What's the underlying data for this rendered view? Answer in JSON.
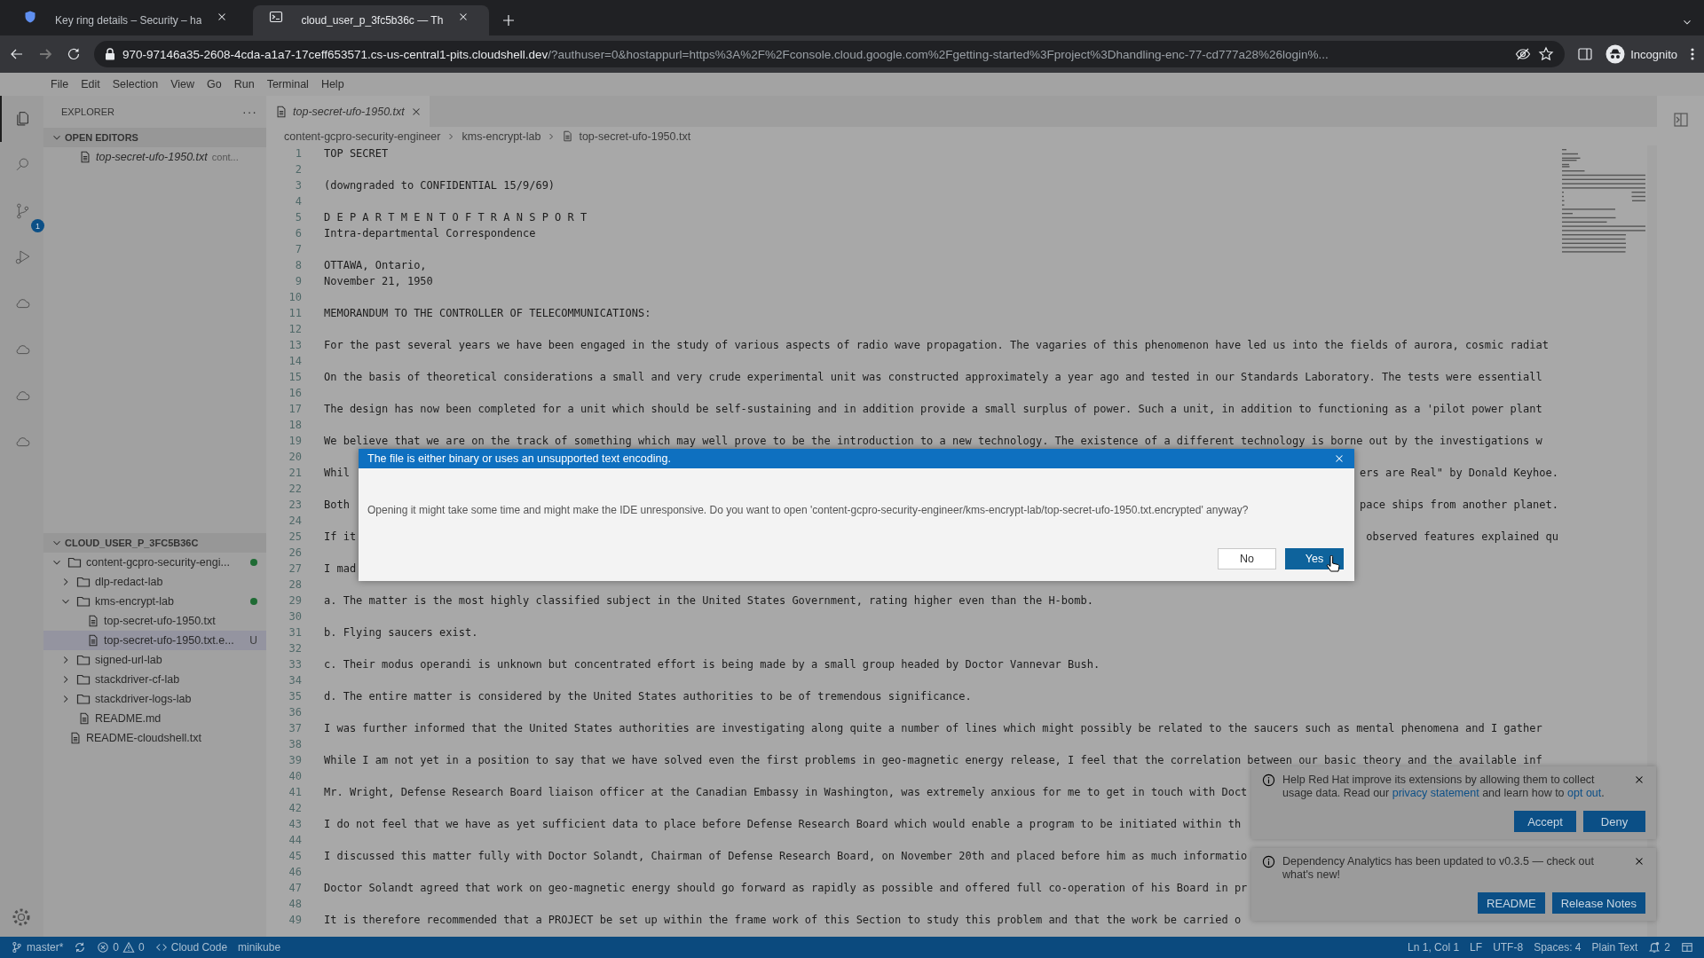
{
  "browser": {
    "tabs": [
      {
        "title": "Key ring details – Security – ha",
        "selected": false
      },
      {
        "title": "cloud_user_p_3fc5b36c — Th",
        "selected": true
      }
    ],
    "url_host": "970-97146a35-2608-4cda-a1a7-17ceff653571.cs-us-central1-pits.cloudshell.dev",
    "url_rest": "/?authuser=0&hostappurl=https%3A%2F%2Fconsole.cloud.google.com%2Fgetting-started%3Fproject%3Dhandling-enc-77-cd777a28%26login%...",
    "profile": "Incognito"
  },
  "menu": [
    "File",
    "Edit",
    "Selection",
    "View",
    "Go",
    "Run",
    "Terminal",
    "Help"
  ],
  "activity_bar": [
    {
      "kind": "explorer",
      "selected": true
    },
    {
      "kind": "search",
      "selected": false
    },
    {
      "kind": "source-control",
      "selected": false,
      "badge": "1"
    },
    {
      "kind": "run-debug",
      "selected": false
    },
    {
      "kind": "cloud",
      "selected": false
    },
    {
      "kind": "cloud",
      "selected": false
    },
    {
      "kind": "cloud",
      "selected": false
    },
    {
      "kind": "cloud",
      "selected": false
    }
  ],
  "sidebar": {
    "title": "EXPLORER",
    "more": "···",
    "open_editors": {
      "title": "OPEN EDITORS",
      "expanded": true,
      "items": [
        {
          "name": "top-secret-ufo-1950.txt",
          "folder": "cont..."
        }
      ]
    },
    "workspace": {
      "title": "CLOUD_USER_P_3FC5B36C",
      "expanded": true,
      "tree": [
        {
          "name": "content-gcpro-security-engi...",
          "kind": "folder",
          "expanded": true,
          "modified": true,
          "selected": false,
          "children": [
            {
              "name": "dlp-redact-lab",
              "kind": "folder",
              "expanded": false,
              "modified": false,
              "selected": false
            },
            {
              "name": "kms-encrypt-lab",
              "kind": "folder",
              "expanded": true,
              "modified": true,
              "selected": false,
              "children": [
                {
                  "name": "top-secret-ufo-1950.txt",
                  "kind": "file",
                  "selected": false
                },
                {
                  "name": "top-secret-ufo-1950.txt.e...",
                  "kind": "file",
                  "selected": true,
                  "status": "U"
                }
              ]
            },
            {
              "name": "signed-url-lab",
              "kind": "folder",
              "expanded": false,
              "modified": false,
              "selected": false
            },
            {
              "name": "stackdriver-cf-lab",
              "kind": "folder",
              "expanded": false,
              "modified": false,
              "selected": false
            },
            {
              "name": "stackdriver-logs-lab",
              "kind": "folder",
              "expanded": false,
              "modified": false,
              "selected": false
            },
            {
              "name": "README.md",
              "kind": "file",
              "selected": false
            }
          ]
        },
        {
          "name": "README-cloudshell.txt",
          "kind": "file",
          "selected": false
        }
      ]
    }
  },
  "editor": {
    "tabs": [
      {
        "title": "top-secret-ufo-1950.txt",
        "selected": true,
        "preview": true
      }
    ],
    "breadcrumb": [
      "content-gcpro-security-engineer",
      "kms-encrypt-lab",
      "top-secret-ufo-1950.txt"
    ],
    "lines": [
      {
        "number": "1",
        "text": "TOP SECRET"
      },
      {
        "number": "2"
      },
      {
        "number": "3",
        "text": "(downgraded to CONFIDENTIAL 15/9/69)"
      },
      {
        "number": "4"
      },
      {
        "number": "5",
        "text": "D E P A R T M E N T O F T R A N S P O R T"
      },
      {
        "number": "6",
        "text": "Intra-departmental Correspondence"
      },
      {
        "number": "7"
      },
      {
        "number": "8",
        "text": "OTTAWA, Ontario,"
      },
      {
        "number": "9",
        "text": "November 21, 1950"
      },
      {
        "number": "10"
      },
      {
        "number": "11",
        "text": "MEMORANDUM TO THE CONTROLLER OF TELECOMMUNICATIONS:"
      },
      {
        "number": "12"
      },
      {
        "number": "13",
        "text": "For the past several years we have been engaged in the study of various aspects of radio wave propagation. The vagaries of this phenomenon have led us into the fields of aurora, cosmic radiat"
      },
      {
        "number": "14"
      },
      {
        "number": "15",
        "text": "On the basis of theoretical considerations a small and very crude experimental unit was constructed approximately a year ago and tested in our Standards Laboratory. The tests were essentiall"
      },
      {
        "number": "16"
      },
      {
        "number": "17",
        "text": "The design has now been completed for a unit which should be self-sustaining and in addition provide a small surplus of power. Such a unit, in addition to functioning as a 'pilot power plant"
      },
      {
        "number": "18"
      },
      {
        "number": "19",
        "text": "We believe that we are on the track of something which may well prove to be the introduction to a new technology. The existence of a different technology is borne out by the investigations w"
      },
      {
        "number": "20"
      },
      {
        "number": "21",
        "text": "Whil",
        "text_right": "ers are Real\" by Donald Keyhoe."
      },
      {
        "number": "22"
      },
      {
        "number": "23",
        "text": "Both",
        "text_right": "pace ships from another planet."
      },
      {
        "number": "24"
      },
      {
        "number": "25",
        "text": "If it",
        "text_right": "observed features explained qu"
      },
      {
        "number": "26"
      },
      {
        "number": "27",
        "text": "I mad"
      },
      {
        "number": "28"
      },
      {
        "number": "29",
        "text": "a. The matter is the most highly classified subject in the United States Government, rating higher even than the H-bomb."
      },
      {
        "number": "30"
      },
      {
        "number": "31",
        "text": "b. Flying saucers exist."
      },
      {
        "number": "32"
      },
      {
        "number": "33",
        "text": "c. Their modus operandi is unknown but concentrated effort is being made by a small group headed by Doctor Vannevar Bush."
      },
      {
        "number": "34"
      },
      {
        "number": "35",
        "text": "d. The entire matter is considered by the United States authorities to be of tremendous significance."
      },
      {
        "number": "36"
      },
      {
        "number": "37",
        "text": "I was further informed that the United States authorities are investigating along quite a number of lines which might possibly be related to the saucers such as mental phenomena and I gather"
      },
      {
        "number": "38"
      },
      {
        "number": "39",
        "text": "While I am not yet in a position to say that we have solved even the first problems in geo-magnetic energy release, I feel that the correlation between our basic theory and the available inf"
      },
      {
        "number": "40"
      },
      {
        "number": "41",
        "text": "Mr. Wright, Defense Research Board liaison officer at the Canadian Embassy in Washington, was extremely anxious for me to get in touch with Doct"
      },
      {
        "number": "42"
      },
      {
        "number": "43",
        "text": "I do not feel that we have as yet sufficient data to place before Defense Research Board which would enable a program to be initiated within th"
      },
      {
        "number": "44"
      },
      {
        "number": "45",
        "text": "I discussed this matter fully with Doctor Solandt, Chairman of Defense Research Board, on November 20th and placed before him as much informatio"
      },
      {
        "number": "46"
      },
      {
        "number": "47",
        "text": "Doctor Solandt agreed that work on geo-magnetic energy should go forward as rapidly as possible and offered full co-operation of his Board in pr"
      },
      {
        "number": "48"
      },
      {
        "number": "49",
        "text": "It is therefore recommended that a PROJECT be set up within the frame work of this Section to study this problem and that the work be carried o"
      }
    ]
  },
  "dialog": {
    "title": "The file is either binary or uses an unsupported text encoding.",
    "message": "Opening it might take some time and might make the IDE unresponsive. Do you want to open 'content-gcpro-security-engineer/kms-encrypt-lab/top-secret-ufo-1950.txt.encrypted' anyway?",
    "buttons": [
      {
        "label": "No",
        "primary": false
      },
      {
        "label": "Yes",
        "primary": true
      }
    ]
  },
  "notifications": [
    {
      "message": [
        {
          "text": "Help Red Hat improve its extensions by allowing them to collect usage data. Read our ",
          "link": false
        },
        {
          "text": "privacy statement",
          "link": true
        },
        {
          "text": " and learn how to ",
          "link": false
        },
        {
          "text": "opt out",
          "link": true
        },
        {
          "text": ".",
          "link": false
        }
      ],
      "buttons": [
        "Accept",
        "Deny"
      ]
    },
    {
      "message": [
        {
          "text": "Dependency Analytics has been updated to v0.3.5 — check out what's new!",
          "link": false
        }
      ],
      "buttons": [
        "README",
        "Release Notes"
      ]
    }
  ],
  "status_bar": {
    "left": [
      {
        "kind": "branch",
        "text": "master*"
      },
      {
        "kind": "sync"
      },
      {
        "kind": "problems",
        "errors": "0",
        "warnings": "0"
      },
      {
        "kind": "remote",
        "text": "Cloud Code"
      },
      {
        "kind": "text",
        "text": "minikube"
      }
    ],
    "right": [
      {
        "kind": "text",
        "text": "Ln 1, Col 1"
      },
      {
        "kind": "text",
        "text": "LF"
      },
      {
        "kind": "text",
        "text": "UTF-8"
      },
      {
        "kind": "text",
        "text": "Spaces: 4"
      },
      {
        "kind": "text",
        "text": "Plain Text"
      },
      {
        "kind": "bell",
        "text": "2"
      },
      {
        "kind": "layout"
      }
    ]
  }
}
